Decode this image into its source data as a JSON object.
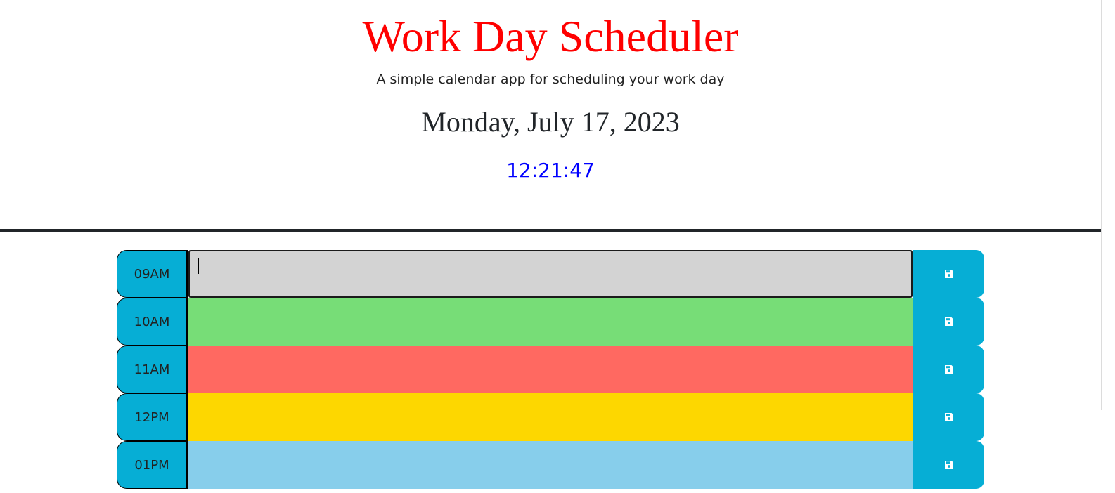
{
  "header": {
    "title": "Work Day Scheduler",
    "subtitle": "A simple calendar app for scheduling your work day",
    "date": "Monday, July 17, 2023",
    "time": "12:21:47"
  },
  "colors": {
    "title": "#ff0000",
    "clock": "#0000ff",
    "accent": "#06aed5",
    "past": "#d3d3d3",
    "present": "#77dd77",
    "future_red": "#ff6961",
    "future_yellow": "#fdd700",
    "future_blue": "#87ceeb"
  },
  "timeblocks": [
    {
      "hour": "09AM",
      "text": "",
      "color": "#d3d3d3",
      "save_icon": "floppy-disk-icon"
    },
    {
      "hour": "10AM",
      "text": "",
      "color": "#77dd77",
      "save_icon": "floppy-disk-icon"
    },
    {
      "hour": "11AM",
      "text": "",
      "color": "#ff6961",
      "save_icon": "floppy-disk-icon"
    },
    {
      "hour": "12PM",
      "text": "",
      "color": "#fdd700",
      "save_icon": "floppy-disk-icon"
    },
    {
      "hour": "01PM",
      "text": "",
      "color": "#87ceeb",
      "save_icon": "floppy-disk-icon"
    }
  ]
}
